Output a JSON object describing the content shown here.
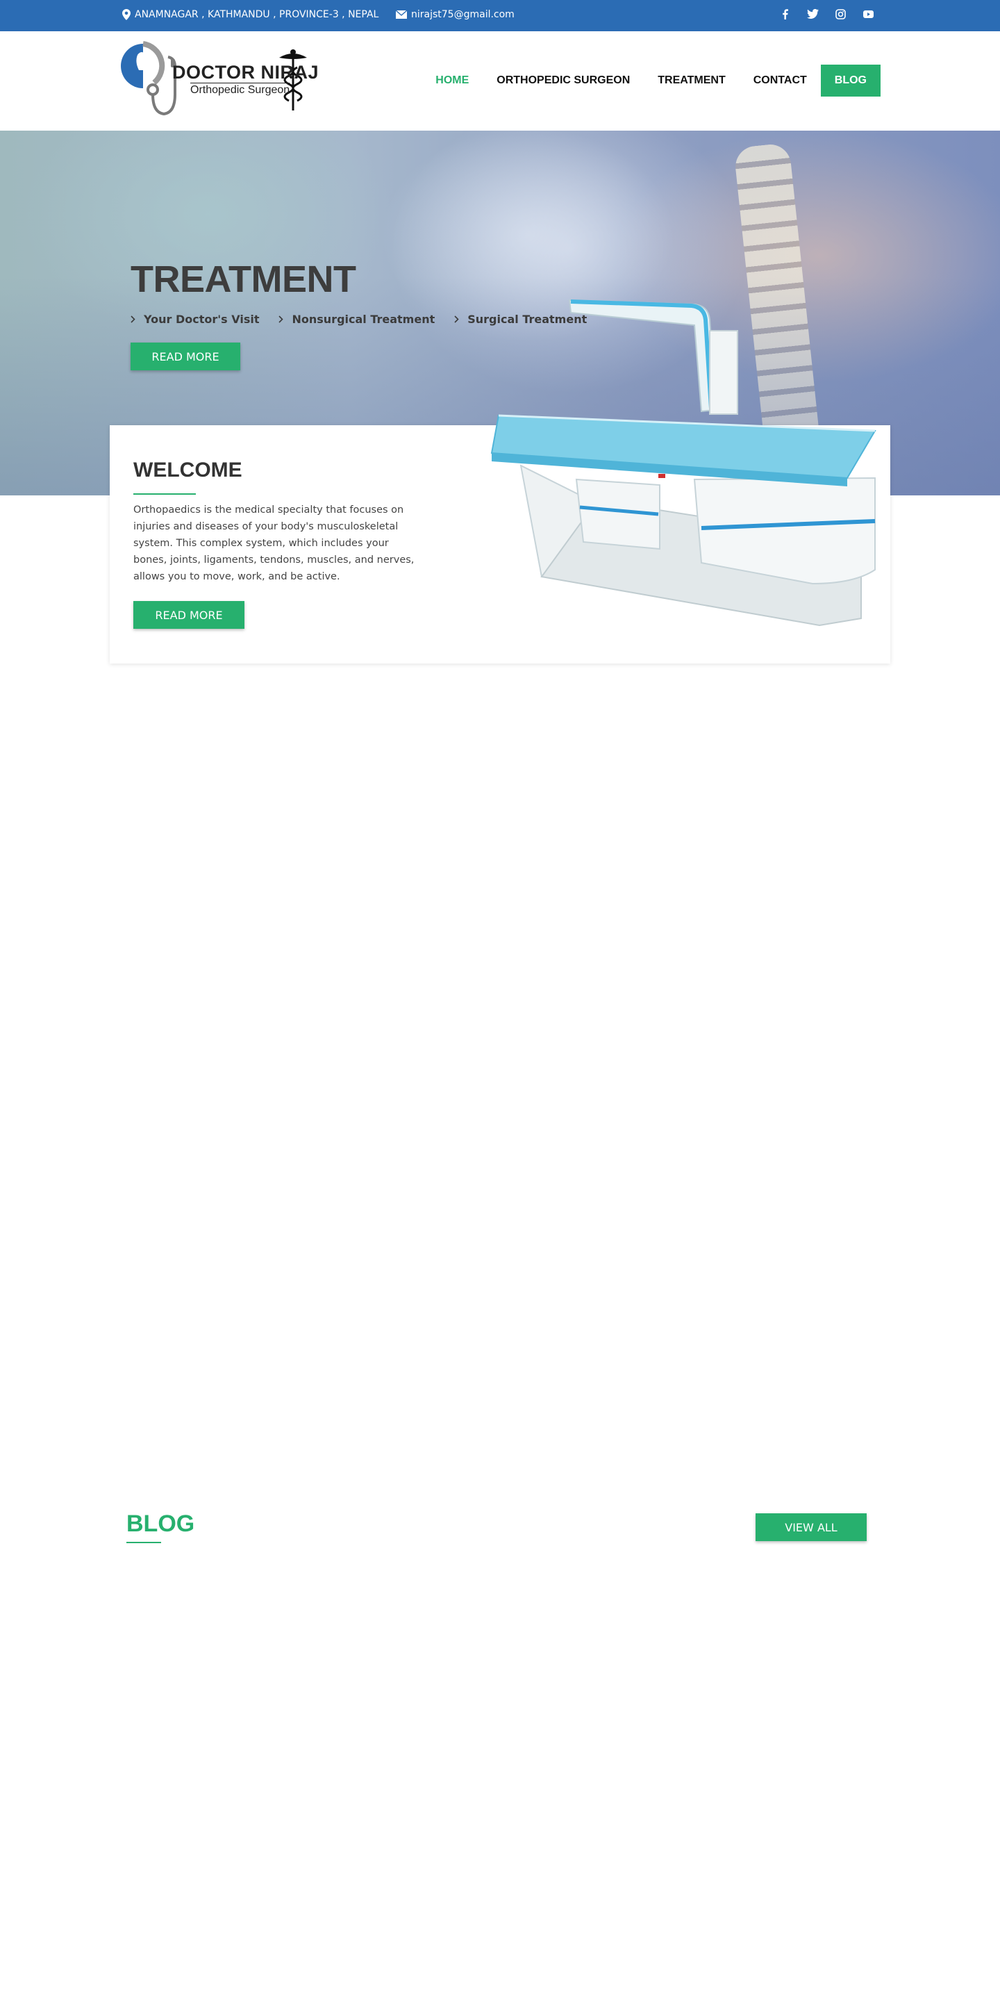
{
  "topbar": {
    "address": "ANAMNAGAR , KATHMANDU , PROVINCE-3 , NEPAL",
    "email": "nirajst75@gmail.com",
    "social": [
      "facebook-icon",
      "twitter-icon",
      "instagram-icon",
      "youtube-icon"
    ],
    "background": "#2b6cb4"
  },
  "header": {
    "logo_brand": "DOCTOR NIRAJ",
    "logo_sub": "Orthopedic Surgeon",
    "nav": [
      {
        "label": "HOME",
        "active": true
      },
      {
        "label": "ORTHOPEDIC SURGEON",
        "active": false
      },
      {
        "label": "TREATMENT",
        "active": false
      },
      {
        "label": "CONTACT",
        "active": false
      },
      {
        "label": "BLOG",
        "active": false,
        "highlight": true
      }
    ]
  },
  "hero": {
    "title": "TREATMENT",
    "links": [
      "Your Doctor's Visit",
      "Nonsurgical Treatment",
      "Surgical Treatment"
    ],
    "button": "READ MORE"
  },
  "welcome": {
    "title": "WELCOME",
    "text": "Orthopaedics is the medical specialty that focuses on injuries and diseases of your body's musculoskeletal system. This complex system, which includes your bones, joints, ligaments, tendons, muscles, and nerves, allows you to move, work, and be active.",
    "button": "READ MORE"
  },
  "blog": {
    "title": "BLOG",
    "view_all": "VIEW ALL"
  },
  "colors": {
    "accent": "#27b06e",
    "topbar": "#2b6cb4",
    "heading": "#333333"
  }
}
